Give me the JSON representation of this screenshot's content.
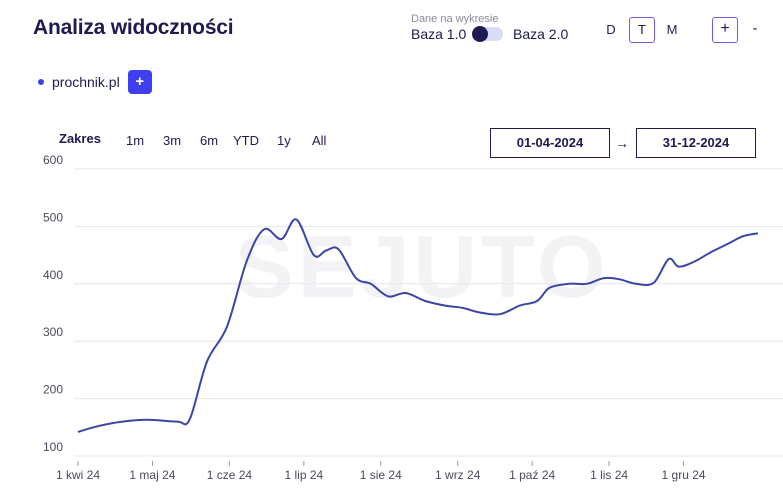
{
  "header": {
    "title": "Analiza widoczności",
    "dane_label": "Dane na wykresie",
    "baza1_label": "Baza 1.0",
    "baza2_label": "Baza 2.0",
    "periods": [
      "D",
      "T",
      "M"
    ],
    "active_period": "T",
    "zoom_in_label": "+",
    "zoom_out_label": "-"
  },
  "domain": {
    "name": "prochnik.pl",
    "add_label": "+"
  },
  "range": {
    "label": "Zakres",
    "buttons": [
      "1m",
      "3m",
      "6m",
      "YTD",
      "1y",
      "All"
    ],
    "start_date": "01-04-2024",
    "end_date": "31-12-2024",
    "arrow": "→"
  },
  "watermark": "SEJUTO",
  "colors": {
    "line": "#3b45a8",
    "accent": "#3f3ff0",
    "toggle_border": "#6b5fe0"
  },
  "chart_data": {
    "type": "line",
    "ylim": [
      100,
      600
    ],
    "yticks": [
      100,
      200,
      300,
      400,
      500,
      600
    ],
    "xtick_labels": [
      "1 kwi 24",
      "1 maj 24",
      "1 cze 24",
      "1 lip 24",
      "1 sie 24",
      "1 wrz 24",
      "1 paź 24",
      "1 lis 24",
      "1 gru 24"
    ],
    "xtick_days": [
      0,
      30,
      61,
      91,
      122,
      153,
      183,
      214,
      244
    ],
    "x": [
      0,
      8,
      18,
      28,
      40,
      45,
      52,
      60,
      68,
      75,
      82,
      88,
      95,
      100,
      105,
      112,
      118,
      125,
      132,
      140,
      148,
      155,
      162,
      170,
      178,
      185,
      190,
      198,
      205,
      212,
      218,
      225,
      232,
      238,
      242,
      248,
      255,
      262,
      268,
      274
    ],
    "y": [
      142,
      152,
      160,
      163,
      160,
      164,
      265,
      325,
      440,
      495,
      478,
      512,
      450,
      458,
      460,
      410,
      400,
      378,
      384,
      370,
      362,
      358,
      350,
      347,
      362,
      370,
      393,
      400,
      400,
      410,
      408,
      400,
      402,
      443,
      430,
      438,
      455,
      470,
      483,
      488
    ]
  }
}
